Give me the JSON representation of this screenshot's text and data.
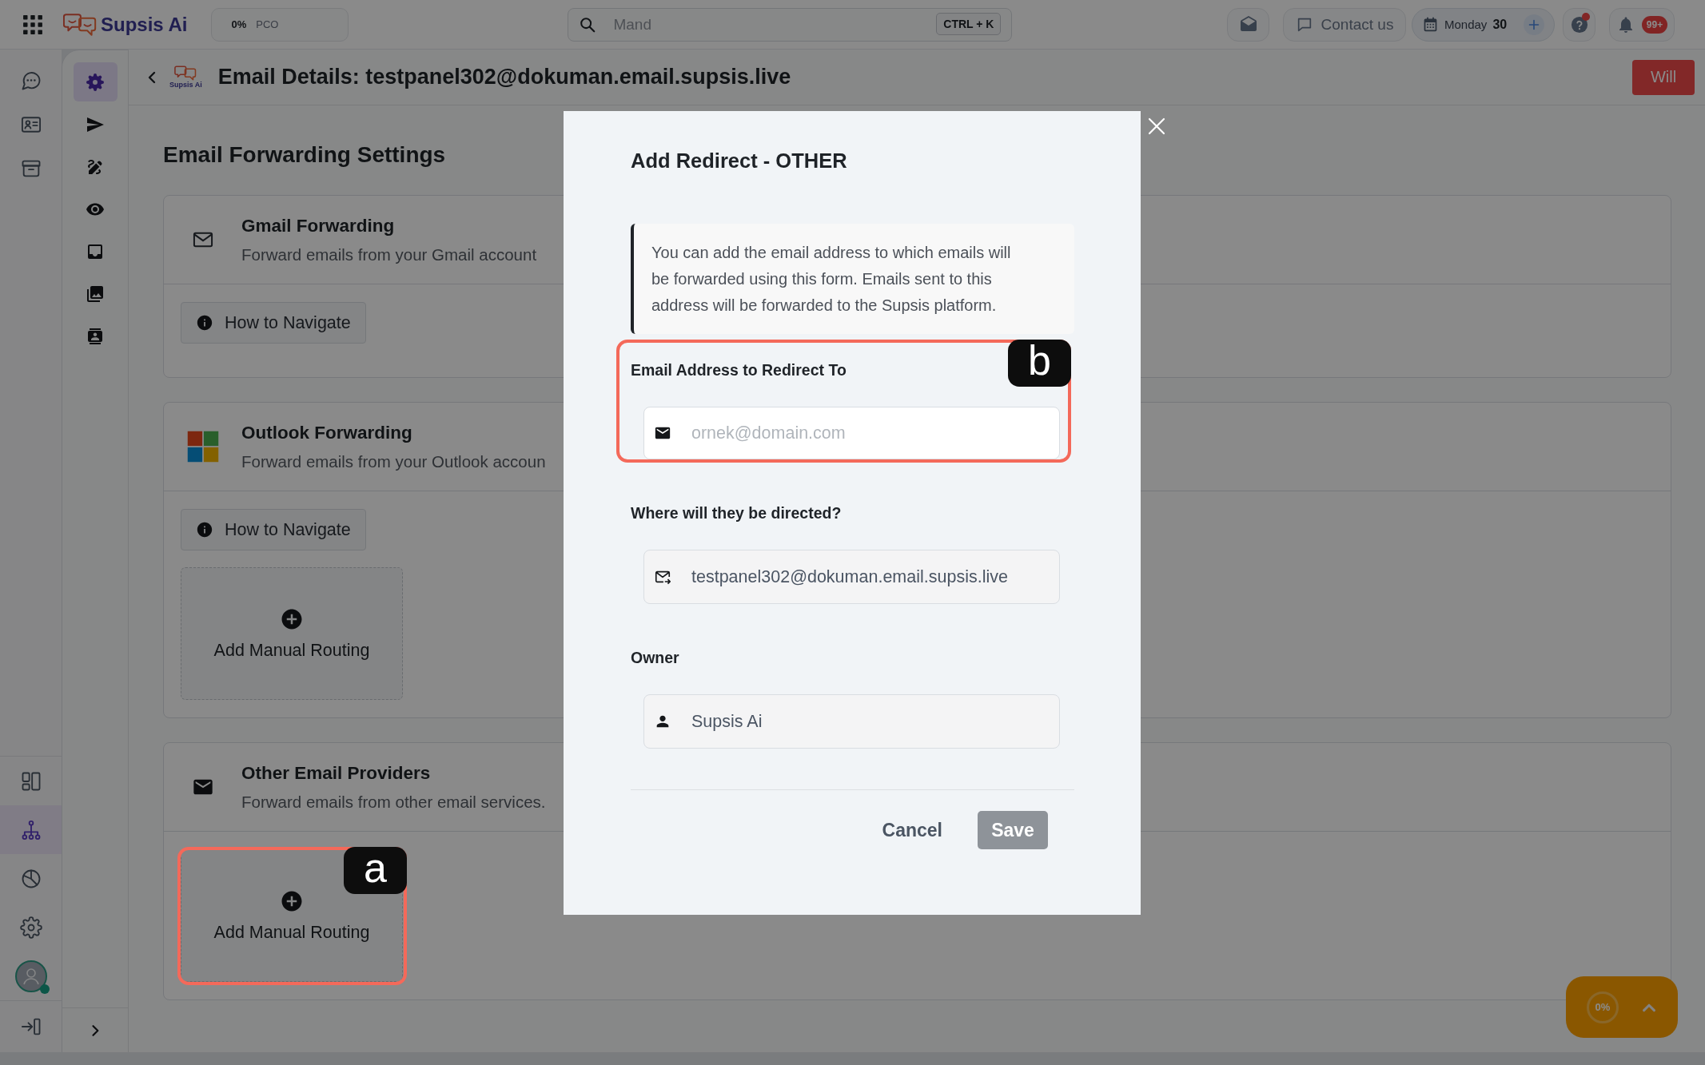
{
  "top_bar": {
    "brand": "Supsis Ai",
    "progress": {
      "percent": "0%",
      "label": "PCO"
    },
    "search": {
      "placeholder": "Mand",
      "shortcut": "CTRL + K"
    },
    "contact": "Contact us",
    "date": {
      "weekday": "Monday",
      "day": "30"
    },
    "help": {
      "alert": true
    },
    "notifications": "99+"
  },
  "nav_rail": {
    "top_items": [
      {
        "selected": false
      },
      {
        "selected": false
      },
      {
        "selected": false
      }
    ],
    "bottom_items": [
      {
        "selected": false
      },
      {
        "selected": true
      },
      {
        "selected": false
      },
      {
        "selected": false
      }
    ],
    "user": {
      "online": true
    }
  },
  "sub_rail": {
    "items": [
      {
        "selected": true
      },
      {
        "selected": false
      },
      {
        "selected": false
      },
      {
        "selected": false
      },
      {
        "selected": false
      },
      {
        "selected": false
      },
      {
        "selected": false
      }
    ]
  },
  "header": {
    "logo_text": "Supsis Ai",
    "title": "Email Details: testpanel302@dokuman.email.supsis.live",
    "action": "Will"
  },
  "settings": {
    "title": "Email Forwarding Settings",
    "cards": [
      {
        "kind": "gmail",
        "title": "Gmail Forwarding",
        "description": "Forward emails from your Gmail account",
        "navigate_button": "How to Navigate"
      },
      {
        "kind": "outlook",
        "title": "Outlook Forwarding",
        "description": "Forward emails from your Outlook accoun",
        "navigate_button": "How to Navigate",
        "add_routing": "Add Manual Routing"
      },
      {
        "kind": "other",
        "title": "Other Email Providers",
        "description": "Forward emails from other email services.",
        "add_routing": "Add Manual Routing",
        "annotation": "a"
      }
    ]
  },
  "modal": {
    "title": "Add Redirect - OTHER",
    "info": "You can add the email address to which emails will be forwarded using this form. Emails sent to this address will be forwarded to the Supsis platform.",
    "fields": [
      {
        "kind": "email",
        "label": "Email Address to Redirect To",
        "placeholder": "ornek@domain.com",
        "disabled": false,
        "annotation": "b"
      },
      {
        "kind": "forward",
        "label": "Where will they be directed?",
        "value": "testpanel302@dokuman.email.supsis.live",
        "disabled": true
      },
      {
        "kind": "owner",
        "label": "Owner",
        "value": "Supsis Ai",
        "disabled": true
      }
    ],
    "cancel": "Cancel",
    "save": {
      "label": "Save",
      "disabled": true
    }
  },
  "progress_widget": {
    "percent": "0%"
  }
}
